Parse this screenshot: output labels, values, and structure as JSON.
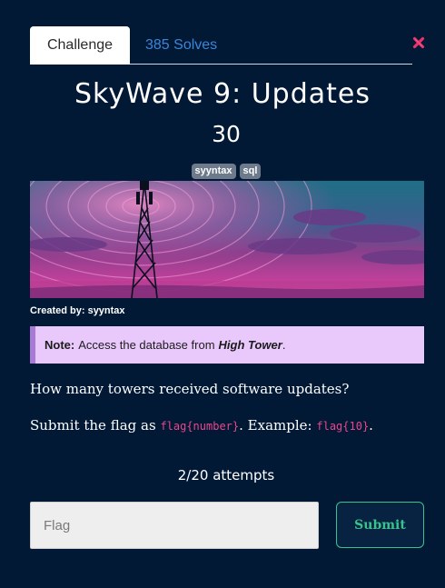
{
  "tabs": {
    "challenge": "Challenge",
    "solves": "385 Solves"
  },
  "challenge": {
    "title": "SkyWave 9: Updates",
    "points": "30",
    "tags": [
      "syyntax",
      "sql"
    ],
    "created_by": "Created by: syyntax"
  },
  "note": {
    "label": "Note:",
    "text": "Access the database from",
    "highlight": "High Tower",
    "end": "."
  },
  "description": {
    "question": "How many towers received software updates?",
    "submit_prefix": "Submit the flag as",
    "flag_format": "flag{number}",
    "example_label": ". Example:",
    "example_flag": "flag{10}",
    "end": "."
  },
  "attempts": "2/20 attempts",
  "flag_input": {
    "placeholder": "Flag",
    "value": ""
  },
  "submit_label": "Submit",
  "colors": {
    "background": "#021936",
    "accent_green": "#38c28e",
    "tab_link": "#3b86d8",
    "note_bg": "#e9c9fb",
    "code_pink": "#e8478c",
    "close_red": "#e8336b"
  },
  "icons": {
    "close": "close-x-icon"
  }
}
